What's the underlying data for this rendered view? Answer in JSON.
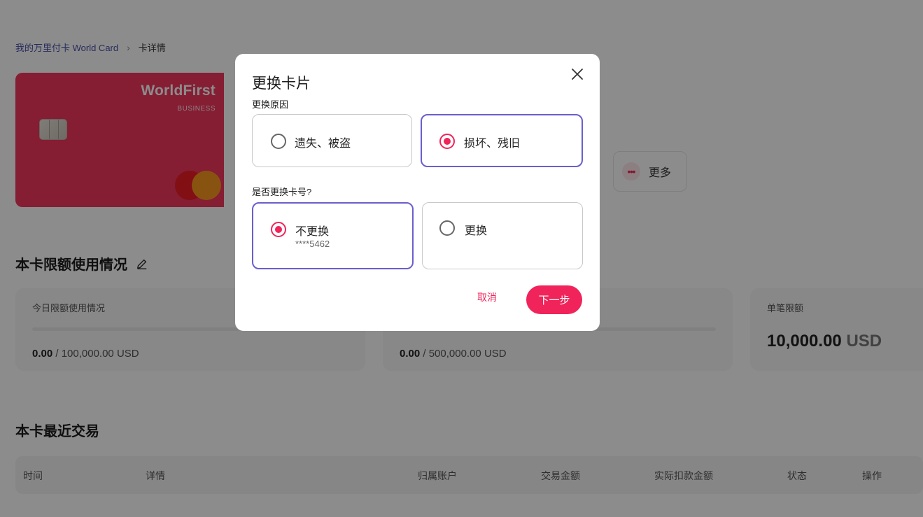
{
  "breadcrumb": {
    "parent": "我的万里付卡 World Card",
    "separator": "›",
    "current": "卡详情"
  },
  "card": {
    "brand": "WorldFirst",
    "sub": "BUSINESS",
    "color": "#f3355e"
  },
  "actions": {
    "more_icon": "•••",
    "more_label": "更多"
  },
  "limits": {
    "title": "本卡限额使用情况",
    "today": {
      "label": "今日限额使用情况",
      "used": "0.00",
      "total": " / 100,000.00 USD",
      "progress": 0
    },
    "monthly": {
      "used": "0.00",
      "total": " / 500,000.00 USD",
      "progress": 0
    },
    "single": {
      "label": "单笔限额",
      "amount": "10,000.00",
      "currency": " USD"
    }
  },
  "transactions": {
    "title": "本卡最近交易",
    "columns": [
      "时间",
      "详情",
      "归属账户",
      "交易金额",
      "实际扣款金额",
      "状态",
      "操作"
    ]
  },
  "dialog": {
    "title": "更换卡片",
    "reason_label": "更换原因",
    "reasons": [
      {
        "label": "遗失、被盗",
        "selected": false
      },
      {
        "label": "损坏、残旧",
        "selected": true
      }
    ],
    "number_label": "是否更换卡号?",
    "number_options": [
      {
        "label": "不更换",
        "sub": "****5462",
        "selected": true
      },
      {
        "label": "更换",
        "selected": false
      }
    ],
    "cancel": "取消",
    "next": "下一步"
  },
  "colors": {
    "accent": "#f0245a",
    "selected_border": "#6a5fcc"
  }
}
